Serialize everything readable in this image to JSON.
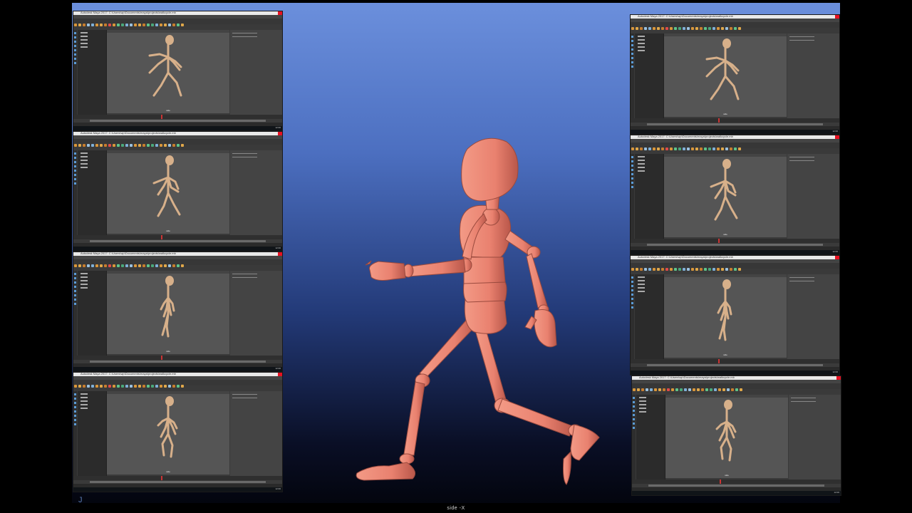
{
  "overlay": {
    "camera_label": "side -X",
    "corner_mark": "J"
  },
  "thumbnail_window": {
    "title": "Autodesk Maya 2017: C:\\Users\\wp\\Documents\\maya\\projects\\walkcycle.mb",
    "viewport_label": "side",
    "clock": "12:00"
  },
  "colors": {
    "stage_top": "#6b8fdc",
    "stage_bottom": "#03050e",
    "mannequin": "#e9816f",
    "mannequin_shade": "#b9574a",
    "thumb_mannequin": "#d7b08a",
    "maya_bg": "#3a3a3a",
    "viewport_bg": "#555555"
  },
  "thumbnails": [
    {
      "id": "left-1",
      "pose": "A"
    },
    {
      "id": "left-2",
      "pose": "B"
    },
    {
      "id": "left-3",
      "pose": "C"
    },
    {
      "id": "left-4",
      "pose": "D"
    },
    {
      "id": "right-1",
      "pose": "A"
    },
    {
      "id": "right-2",
      "pose": "B"
    },
    {
      "id": "right-3",
      "pose": "C"
    },
    {
      "id": "right-4",
      "pose": "D"
    }
  ]
}
